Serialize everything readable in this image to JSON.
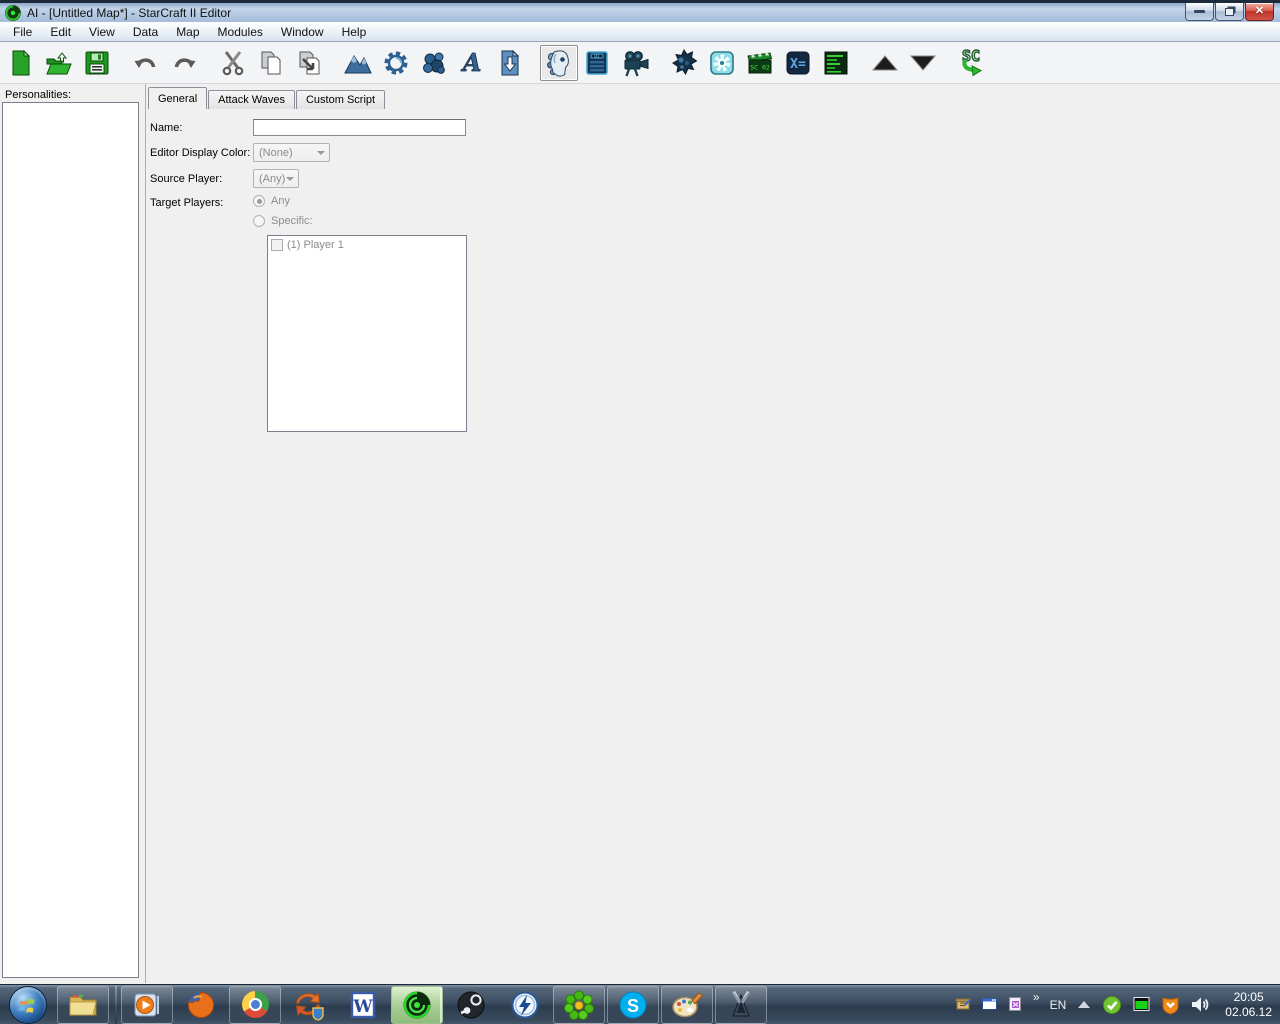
{
  "window": {
    "title": "AI - [Untitled Map*] - StarCraft II Editor",
    "app_icon": "sc2-editor-swirl-icon",
    "controls": {
      "minimize": "minimize",
      "restore": "restore",
      "close": "close"
    }
  },
  "colors": {
    "titlebar": "#b3c9e2",
    "menubar": "#e4ecf6",
    "content_bg": "#f0f0f0",
    "taskbar": "#3c4d61",
    "active_task_green": "#a9cf96",
    "module_icon_blue": "#2e5f91",
    "editor_green": "#27a327",
    "disabled_text": "#8b8b8b"
  },
  "menu": {
    "items": [
      "File",
      "Edit",
      "View",
      "Data",
      "Map",
      "Modules",
      "Window",
      "Help"
    ]
  },
  "toolbar": {
    "buttons": [
      {
        "name": "new-document"
      },
      {
        "name": "open-map"
      },
      {
        "name": "save-map"
      },
      {
        "name": "undo"
      },
      {
        "name": "redo"
      },
      {
        "name": "cut"
      },
      {
        "name": "copy"
      },
      {
        "name": "paste"
      },
      {
        "name": "terrain-module"
      },
      {
        "name": "triggers-module"
      },
      {
        "name": "data-module"
      },
      {
        "name": "text-module"
      },
      {
        "name": "import-module"
      },
      {
        "name": "ai-module",
        "selected": true
      },
      {
        "name": "ui-module",
        "text": "UI"
      },
      {
        "name": "cutscene-module"
      },
      {
        "name": "overview-manager"
      },
      {
        "name": "galaxy-module"
      },
      {
        "name": "cutscene-clapper",
        "text": "SC 02"
      },
      {
        "name": "variables-module",
        "text": "X="
      },
      {
        "name": "script-module"
      },
      {
        "name": "move-up"
      },
      {
        "name": "move-down"
      },
      {
        "name": "test-document",
        "text": "SC"
      }
    ]
  },
  "sidebar": {
    "label": "Personalities:"
  },
  "main": {
    "tabs": [
      {
        "label": "General",
        "active": true
      },
      {
        "label": "Attack Waves",
        "active": false
      },
      {
        "label": "Custom Script",
        "active": false
      }
    ],
    "form": {
      "name_label": "Name:",
      "name_value": "",
      "color_label": "Editor Display Color:",
      "color_value": "(None)",
      "source_label": "Source Player:",
      "source_value": "(Any)",
      "target_label": "Target Players:",
      "target_any_label": "Any",
      "target_specific_label": "Specific:",
      "target_selected": "any",
      "players": [
        {
          "label": "(1) Player 1",
          "checked": false
        }
      ]
    }
  },
  "taskbar": {
    "items": [
      {
        "name": "start-button"
      },
      {
        "name": "explorer",
        "running": true
      },
      {
        "name": "media-player",
        "running": true
      },
      {
        "name": "firefox",
        "running": false
      },
      {
        "name": "chrome",
        "running": true
      },
      {
        "name": "sync-app",
        "running": false
      },
      {
        "name": "word",
        "running": false
      },
      {
        "name": "sc2-editor",
        "running": true,
        "active": true
      },
      {
        "name": "steam",
        "running": false
      },
      {
        "name": "daemon-tools",
        "running": false
      },
      {
        "name": "icq",
        "running": true
      },
      {
        "name": "skype",
        "running": true
      },
      {
        "name": "paint",
        "running": true
      },
      {
        "name": "starcraft2",
        "running": true
      }
    ],
    "tray": {
      "mini_icons": [
        "scroll-icon",
        "window-icon",
        "purple-app-icon"
      ],
      "overflow_chevron": "»",
      "language": "EN",
      "icons": [
        "hidden-icons-arrow",
        "antivirus-check-icon",
        "screen-share-icon",
        "security-shield-icon",
        "volume-icon"
      ],
      "time": "20:05",
      "date": "02.06.12"
    }
  }
}
